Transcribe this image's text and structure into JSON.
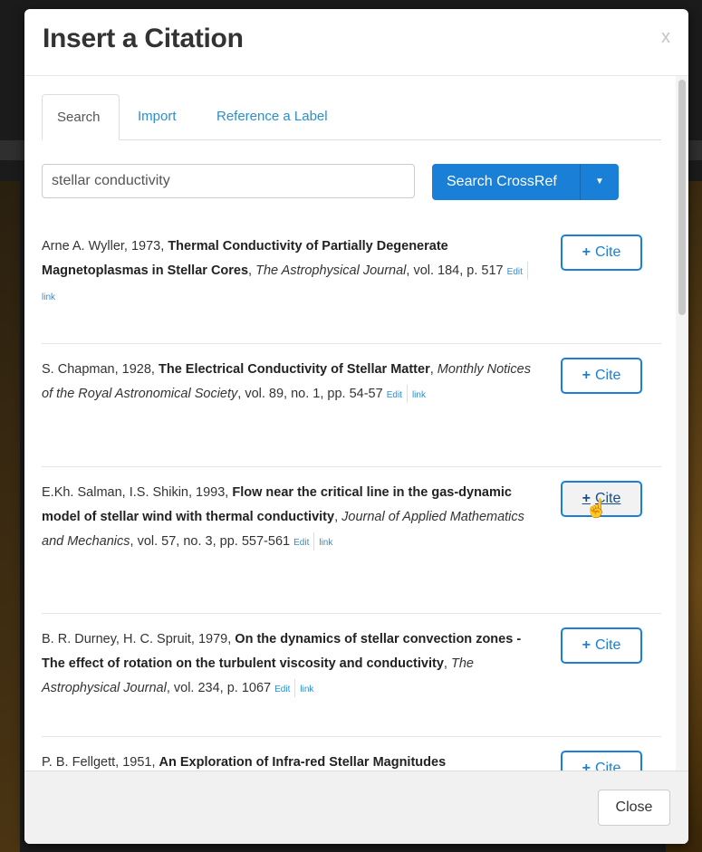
{
  "dialog": {
    "title": "Insert a Citation",
    "close_x": "x",
    "close_label": "Close"
  },
  "tabs": [
    {
      "label": "Search",
      "active": true
    },
    {
      "label": "Import",
      "active": false
    },
    {
      "label": "Reference a Label",
      "active": false
    }
  ],
  "search": {
    "query": "stellar conductivity",
    "button_label": "Search CrossRef",
    "caret": "▼"
  },
  "cite_label": "Cite",
  "edit_label": "Edit",
  "link_label": "link",
  "results": [
    {
      "authors_year": "Arne A. Wyller, 1973, ",
      "title": "Thermal Conductivity of Partially Degenerate Magnetoplasmas in Stellar Cores",
      "journal": "The Astrophysical Journal",
      "details": ", vol. 184, p. 517"
    },
    {
      "authors_year": "S. Chapman, 1928, ",
      "title": "The Electrical Conductivity of Stellar Matter",
      "journal": "Monthly Notices of the Royal Astronomical Society",
      "details": ", vol. 89, no. 1, pp. 54-57"
    },
    {
      "authors_year": "E.Kh. Salman, I.S. Shikin, 1993, ",
      "title": "Flow near the critical line in the gas-dynamic model of stellar wind with thermal conductivity",
      "journal": "Journal of Applied Mathematics and Mechanics",
      "details": ", vol. 57, no. 3, pp. 557-561"
    },
    {
      "authors_year": "B. R. Durney, H. C. Spruit, 1979, ",
      "title": "On the dynamics of stellar convection zones - The effect of rotation on the turbulent viscosity and conductivity",
      "journal": "The Astrophysical Journal",
      "details": ", vol. 234, p. 1067"
    },
    {
      "authors_year": "P. B. Fellgett, 1951, ",
      "title": "An Exploration of Infra-red Stellar Magnitudes",
      "journal": "",
      "details": ""
    }
  ]
}
